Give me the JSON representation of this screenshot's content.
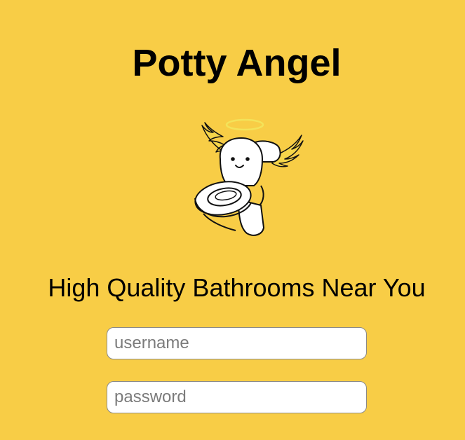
{
  "app": {
    "title": "Potty Angel",
    "tagline": "High Quality Bathrooms Near You"
  },
  "mascot": {
    "icon": "angel-toilet-icon",
    "colors": {
      "halo": "#f3e35a",
      "wings": "#f6d64a",
      "body": "#ffffff",
      "outline": "#111111"
    }
  },
  "login": {
    "username": {
      "value": "",
      "placeholder": "username"
    },
    "password": {
      "value": "",
      "placeholder": "password"
    }
  },
  "colors": {
    "background": "#f8cd46",
    "field_border": "#8a8a8a"
  }
}
